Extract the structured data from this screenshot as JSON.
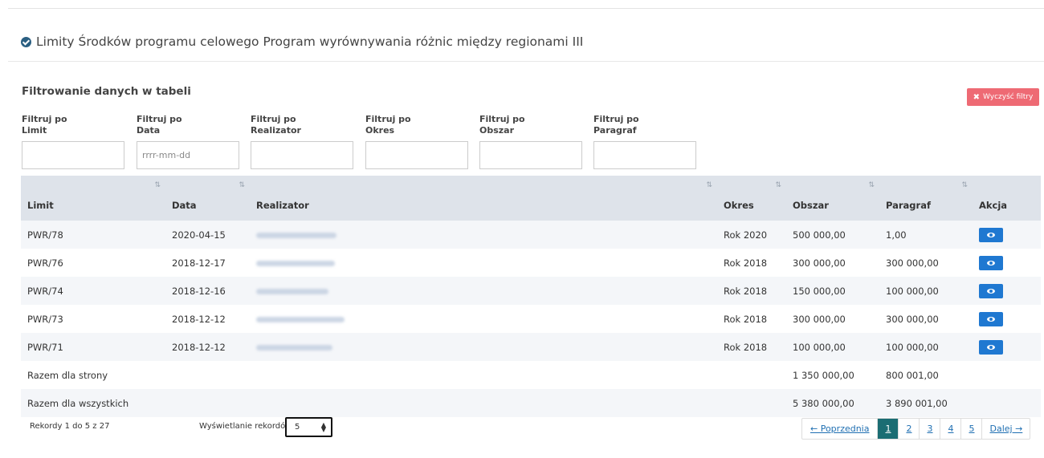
{
  "page": {
    "title": "Limity Środków programu celowego Program wyrównywania różnic między regionami III"
  },
  "filters": {
    "heading": "Filtrowanie danych w tabeli",
    "clear_button": "Wyczyść filtry",
    "fields": [
      {
        "label": "Filtruj po\nLimit",
        "value": "",
        "placeholder": ""
      },
      {
        "label": "Filtruj po\nData",
        "value": "",
        "placeholder": "rrrr-mm-dd"
      },
      {
        "label": "Filtruj po\nRealizator",
        "value": "",
        "placeholder": ""
      },
      {
        "label": "Filtruj po\nOkres",
        "value": "",
        "placeholder": ""
      },
      {
        "label": "Filtruj po\nObszar",
        "value": "",
        "placeholder": ""
      },
      {
        "label": "Filtruj po\nParagraf",
        "value": "",
        "placeholder": ""
      }
    ]
  },
  "table": {
    "columns": [
      "Limit",
      "Data",
      "Realizator",
      "Okres",
      "Obszar",
      "Paragraf",
      "Akcja"
    ],
    "rows": [
      {
        "limit": "PWR/78",
        "data": "2020-04-15",
        "okres": "Rok 2020",
        "obszar": "500 000,00",
        "paragraf": "1,00"
      },
      {
        "limit": "PWR/76",
        "data": "2018-12-17",
        "okres": "Rok 2018",
        "obszar": "300 000,00",
        "paragraf": "300 000,00"
      },
      {
        "limit": "PWR/74",
        "data": "2018-12-16",
        "okres": "Rok 2018",
        "obszar": "150 000,00",
        "paragraf": "100 000,00"
      },
      {
        "limit": "PWR/73",
        "data": "2018-12-12",
        "okres": "Rok 2018",
        "obszar": "300 000,00",
        "paragraf": "300 000,00"
      },
      {
        "limit": "PWR/71",
        "data": "2018-12-12",
        "okres": "Rok 2018",
        "obszar": "100 000,00",
        "paragraf": "100 000,00"
      }
    ],
    "totals": [
      {
        "label": "Razem dla strony",
        "obszar": "1 350 000,00",
        "paragraf": "800 001,00"
      },
      {
        "label": "Razem dla wszystkich",
        "obszar": "5 380 000,00",
        "paragraf": "3 890 001,00"
      }
    ]
  },
  "footer": {
    "records_info": "Rekordy 1 do 5 z 27",
    "show_label": "Wyświetlanie rekordów",
    "page_size": "5",
    "pagination": {
      "prev": "← Poprzednia",
      "pages": [
        "1",
        "2",
        "3",
        "4",
        "5"
      ],
      "active_page": "1",
      "next": "Dalej →"
    }
  },
  "colors": {
    "header_bg": "#dee3ea",
    "clear_button": "#ee6a74",
    "action_button": "#1f78d1",
    "active_page": "#1b6d73"
  }
}
